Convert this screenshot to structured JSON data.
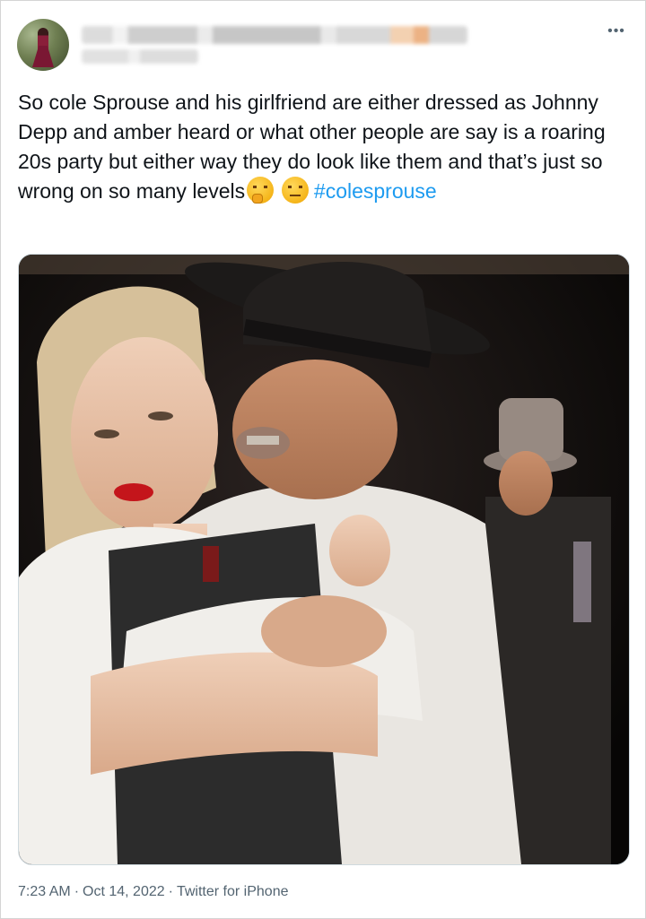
{
  "tweet": {
    "more_icon": "more-horizontal-icon",
    "text_main": "So cole Sprouse and his girlfriend are either dressed as Johnny Depp and amber heard or what other people are say is a roaring 20s party but either way they do look like them and that’s just so wrong on so many levels",
    "emojis": [
      "thinking-face-emoji",
      "unamused-face-emoji"
    ],
    "hashtag": "#colesprouse",
    "time": "7:23 AM",
    "date": "Oct 14, 2022",
    "separator": "·",
    "source": "Twitter for iPhone"
  },
  "colors": {
    "link": "#1d9bf0",
    "text": "#0f1419",
    "secondary": "#536471"
  }
}
